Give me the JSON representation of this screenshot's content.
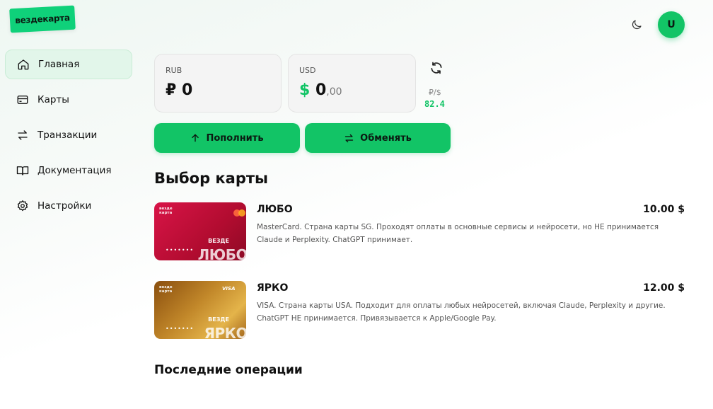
{
  "logo": {
    "text": "вездекарта"
  },
  "header": {
    "avatar_letter": "U"
  },
  "sidebar": {
    "items": [
      {
        "label": "Главная",
        "icon": "home-icon",
        "active": true
      },
      {
        "label": "Карты",
        "icon": "card-icon"
      },
      {
        "label": "Транзакции",
        "icon": "transfer-icon"
      },
      {
        "label": "Документация",
        "icon": "book-icon"
      },
      {
        "label": "Настройки",
        "icon": "gear-icon"
      }
    ]
  },
  "balances": {
    "rub": {
      "label": "RUB",
      "symbol": "₽",
      "value": "0"
    },
    "usd": {
      "label": "USD",
      "symbol": "$",
      "value": "0",
      "cents": ",00"
    },
    "rate": {
      "label": "₽/$",
      "value": "82.4"
    }
  },
  "actions": {
    "topup": "Пополнить",
    "exchange": "Обменять"
  },
  "section_title": "Выбор карты",
  "cards": [
    {
      "name": "ЛЮБО",
      "price": "10.00 $",
      "description": "MasterCard. Страна карты SG. Проходят оплаты в основные сервисы и нейросети, но НЕ принимается Claude и Perplexity. ChatGPT принимает.",
      "brand_small": "везде\nкарта",
      "vezde": "ВЕЗДЕ",
      "big": "ЛЮБО",
      "dots": "•••••••",
      "network": "MasterCard",
      "color": "#c5103a"
    },
    {
      "name": "ЯРКО",
      "price": "12.00 $",
      "description": "VISA. Страна карты USA. Подходит для оплаты любых нейросетей, включая Claude, Perplexity и другие. ChatGPT НЕ принимается. Привязывается к Apple/Google Pay.",
      "brand_small": "везде\nкарта",
      "vezde": "ВЕЗДЕ",
      "big": "ЯРКО",
      "dots": "•••••••",
      "network": "VISA",
      "color": "#b8781a"
    }
  ],
  "recent_title": "Последние операции",
  "colors": {
    "accent": "#12c466",
    "logo": "#0fd17a"
  }
}
